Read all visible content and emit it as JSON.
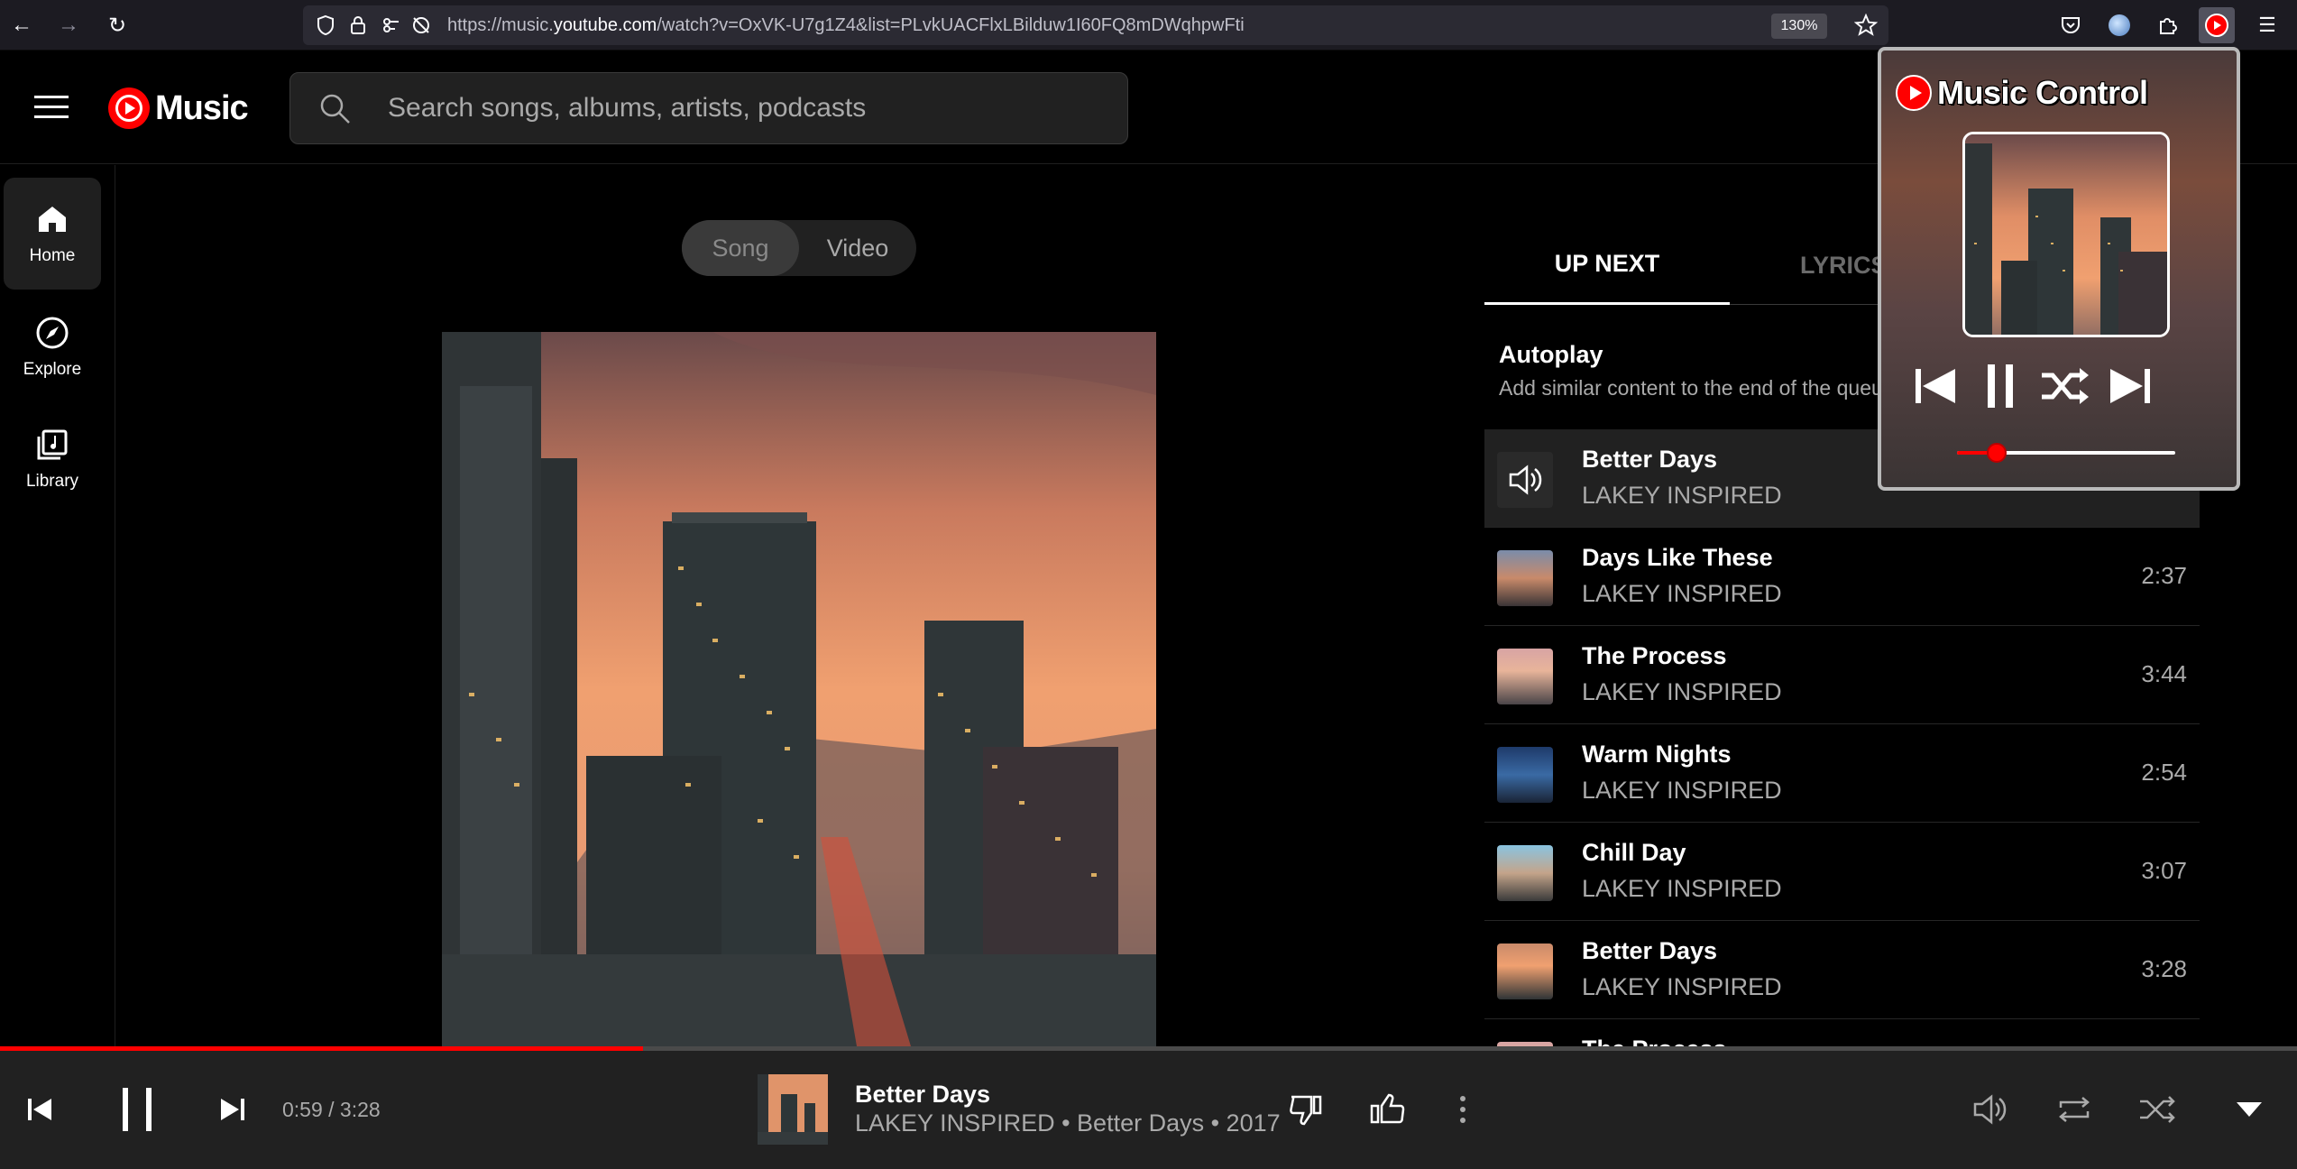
{
  "browser": {
    "url_prefix": "https://music.",
    "url_domain": "youtube.com",
    "url_rest": "/watch?v=OxVK-U7g1Z4&list=PLvkUACFlxLBilduw1I60FQ8mDWqhpwFti",
    "zoom": "130%"
  },
  "header": {
    "logo_text": "Music",
    "search_placeholder": "Search songs, albums, artists, podcasts"
  },
  "sidebar": {
    "items": [
      {
        "label": "Home"
      },
      {
        "label": "Explore"
      },
      {
        "label": "Library"
      }
    ]
  },
  "player_tabs": {
    "song": "Song",
    "video": "Video"
  },
  "side_panel": {
    "tab_upnext": "UP NEXT",
    "tab_lyrics": "LYRICS",
    "autoplay_title": "Autoplay",
    "autoplay_sub": "Add similar content to the end of the queue"
  },
  "queue": [
    {
      "title": "Better Days",
      "artist": "LAKEY INSPIRED",
      "duration": ""
    },
    {
      "title": "Days Like These",
      "artist": "LAKEY INSPIRED",
      "duration": "2:37"
    },
    {
      "title": "The Process",
      "artist": "LAKEY INSPIRED",
      "duration": "3:44"
    },
    {
      "title": "Warm Nights",
      "artist": "LAKEY INSPIRED",
      "duration": "2:54"
    },
    {
      "title": "Chill Day",
      "artist": "LAKEY INSPIRED",
      "duration": "3:07"
    },
    {
      "title": "Better Days",
      "artist": "LAKEY INSPIRED",
      "duration": "3:28"
    },
    {
      "title": "The Process",
      "artist": "",
      "duration": ""
    }
  ],
  "popup": {
    "title": "Music Control",
    "progress_fraction": 0.18
  },
  "player": {
    "time": "0:59 / 3:28",
    "progress_fraction": 0.28,
    "now_title": "Better Days",
    "now_sub": "LAKEY INSPIRED • Better Days • 2017"
  },
  "colors": {
    "accent": "#ff0000",
    "background": "#000000",
    "bar": "#212121",
    "muted_text": "#aaaaaa"
  }
}
